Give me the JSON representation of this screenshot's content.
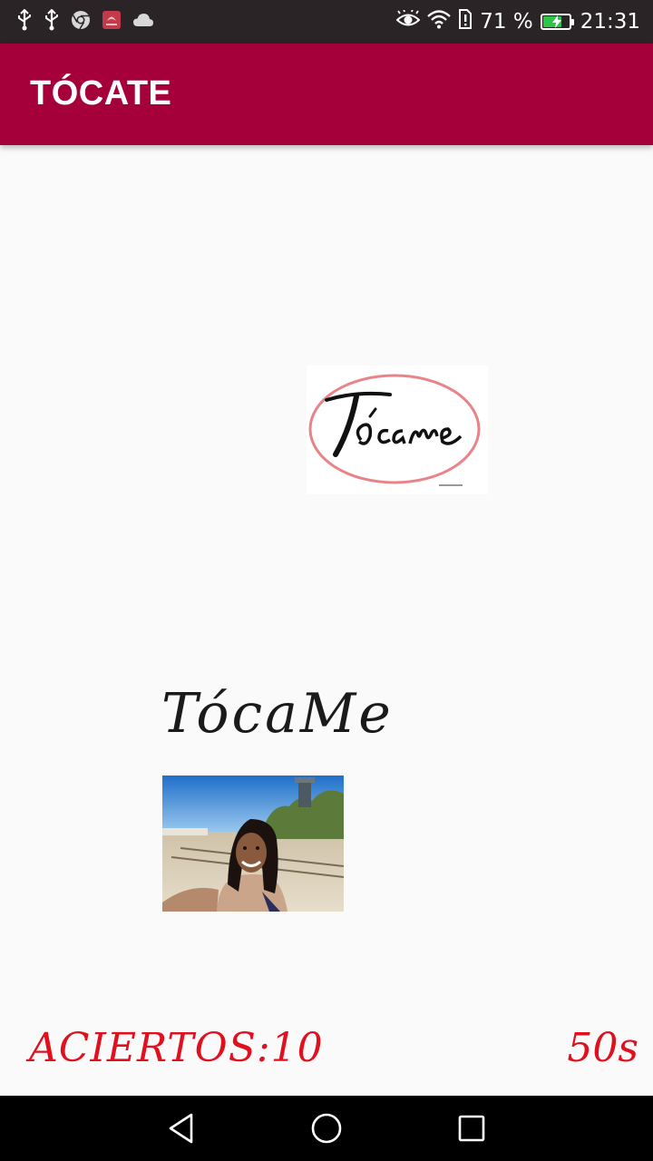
{
  "status_bar": {
    "left_icons": [
      "usb-icon",
      "usb-icon",
      "chrome-icon",
      "huawei-app-icon",
      "cloud-icon"
    ],
    "right_icons": [
      "eye-comfort-icon",
      "wifi-icon",
      "sim-alert-icon",
      "battery-charging-icon"
    ],
    "battery_percent_text": "71 %",
    "battery_level": 0.71,
    "time": "21:31"
  },
  "app_bar": {
    "title": "TÓCATE",
    "color": "#a5003a"
  },
  "game": {
    "target_image_text": "Tócame",
    "question_text": "TócaMe",
    "photo_description_icon": "selfie-photo",
    "score_label": "ACIERTOS:10",
    "timer": "50s",
    "accent_color": "#e0101e"
  },
  "nav_bar": {
    "buttons": [
      "back-icon",
      "home-icon",
      "recents-icon"
    ]
  }
}
